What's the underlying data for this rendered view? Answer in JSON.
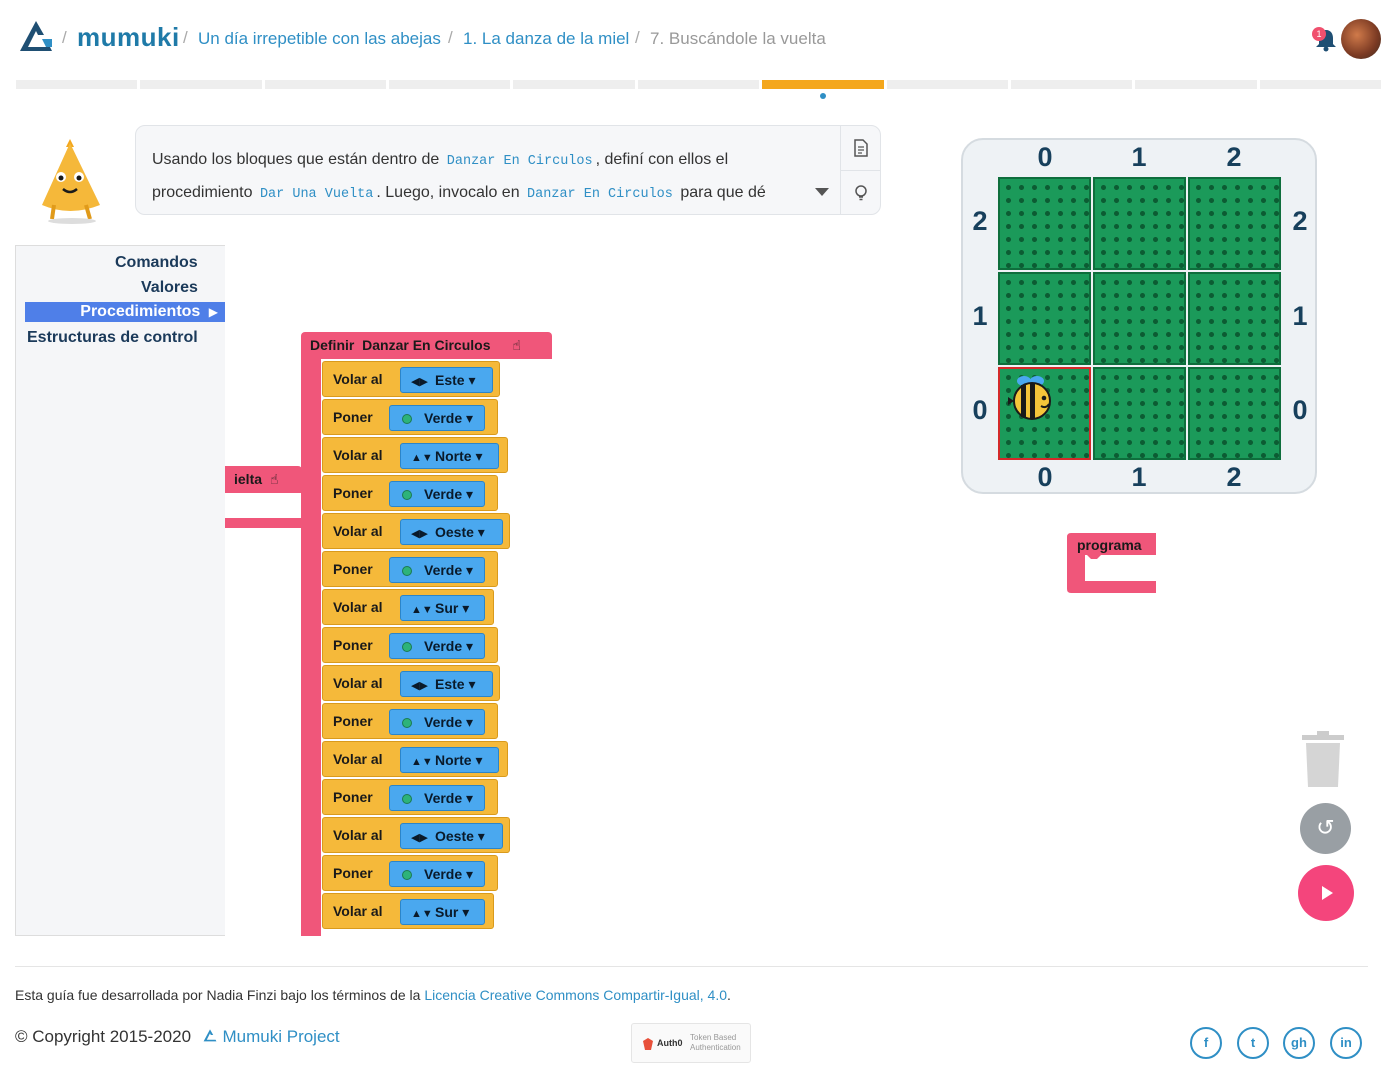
{
  "header": {
    "brand": "mumuki",
    "breadcrumbs": [
      {
        "label": "Un día irrepetible con las abejas"
      },
      {
        "label": "1. La danza de la miel"
      },
      {
        "label": "7. Buscándole la vuelta"
      }
    ],
    "notification_count": "1",
    "progress": {
      "segments": 11,
      "active_index": 6
    }
  },
  "exercise": {
    "text_1": "Usando los bloques que están dentro de",
    "code_1": "Danzar En Circulos",
    "text_2": ", definí con ellos el procedimiento",
    "code_2": "Dar Una Vuelta",
    "text_3": ". Luego, invocalo en",
    "code_3": "Danzar En Circulos",
    "text_4": "para que dé"
  },
  "toolbox": {
    "items": [
      "Comandos",
      "Valores",
      "Procedimientos",
      "Estructuras de control"
    ],
    "selected": "Procedimientos"
  },
  "workspace": {
    "partial_block_label": "ielta",
    "define_label": "Definir",
    "procedure_name": "Danzar En Circulos",
    "commands": [
      {
        "verb": "Volar al",
        "arg": "Este",
        "icon": "arrows-horizontal-icon"
      },
      {
        "verb": "Poner",
        "arg": "Verde",
        "icon": "green-dot-icon"
      },
      {
        "verb": "Volar al",
        "arg": "Norte",
        "icon": "arrows-vertical-icon"
      },
      {
        "verb": "Poner",
        "arg": "Verde",
        "icon": "green-dot-icon"
      },
      {
        "verb": "Volar al",
        "arg": "Oeste",
        "icon": "arrows-horizontal-icon"
      },
      {
        "verb": "Poner",
        "arg": "Verde",
        "icon": "green-dot-icon"
      },
      {
        "verb": "Volar al",
        "arg": "Sur",
        "icon": "arrows-vertical-icon"
      },
      {
        "verb": "Poner",
        "arg": "Verde",
        "icon": "green-dot-icon"
      },
      {
        "verb": "Volar al",
        "arg": "Este",
        "icon": "arrows-horizontal-icon"
      },
      {
        "verb": "Poner",
        "arg": "Verde",
        "icon": "green-dot-icon"
      },
      {
        "verb": "Volar al",
        "arg": "Norte",
        "icon": "arrows-vertical-icon"
      },
      {
        "verb": "Poner",
        "arg": "Verde",
        "icon": "green-dot-icon"
      },
      {
        "verb": "Volar al",
        "arg": "Oeste",
        "icon": "arrows-horizontal-icon"
      },
      {
        "verb": "Poner",
        "arg": "Verde",
        "icon": "green-dot-icon"
      },
      {
        "verb": "Volar al",
        "arg": "Sur",
        "icon": "arrows-vertical-icon"
      }
    ],
    "program_block_label": "programa"
  },
  "scene": {
    "columns": [
      "0",
      "1",
      "2"
    ],
    "rows": [
      "2",
      "1",
      "0"
    ],
    "bee_position": {
      "col": 0,
      "row": 0
    },
    "colors": {
      "cell": "#1b9a5a",
      "selected_border": "#d42a2a"
    }
  },
  "footer": {
    "license_text": "Esta guía fue desarrollada por Nadia Finzi bajo los términos de la",
    "license_link": "Licencia Creative Commons Compartir-Igual, 4.0",
    "license_end": ".",
    "copyright": "© Copyright 2015-2020",
    "project": "Mumuki Project",
    "auth0_brand": "Auth0",
    "auth0_tagline_1": "Token Based",
    "auth0_tagline_2": "Authentication",
    "social": [
      "f",
      "t",
      "gh",
      "in"
    ]
  },
  "colors": {
    "accent": "#2f8fc5",
    "progress_active": "#f4a71d",
    "procedure_block": "#f0567a",
    "command_block": "#f5b93a",
    "dropdown": "#4aa8ef",
    "run_button": "#f4457c"
  }
}
